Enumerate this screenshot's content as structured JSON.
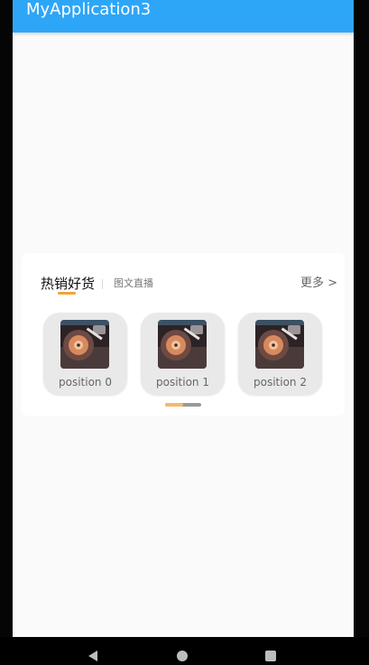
{
  "app_bar": {
    "title": "MyApplication3",
    "color": "#2EA6F8"
  },
  "section": {
    "tabs": [
      {
        "label": "热销好货",
        "selected": true
      },
      {
        "label": "图文直播",
        "selected": false
      }
    ],
    "more_label": "更多 >",
    "accent_color": "#F5A23A",
    "items": [
      {
        "label": "position 0",
        "icon": "record-player-thumbnail"
      },
      {
        "label": "position 1",
        "icon": "record-player-thumbnail"
      },
      {
        "label": "position 2",
        "icon": "record-player-thumbnail"
      }
    ],
    "pager": {
      "progress": 0.5
    }
  },
  "navigation": {
    "back_icon": "back-triangle-icon",
    "home_icon": "home-circle-icon",
    "recents_icon": "recents-square-icon"
  }
}
